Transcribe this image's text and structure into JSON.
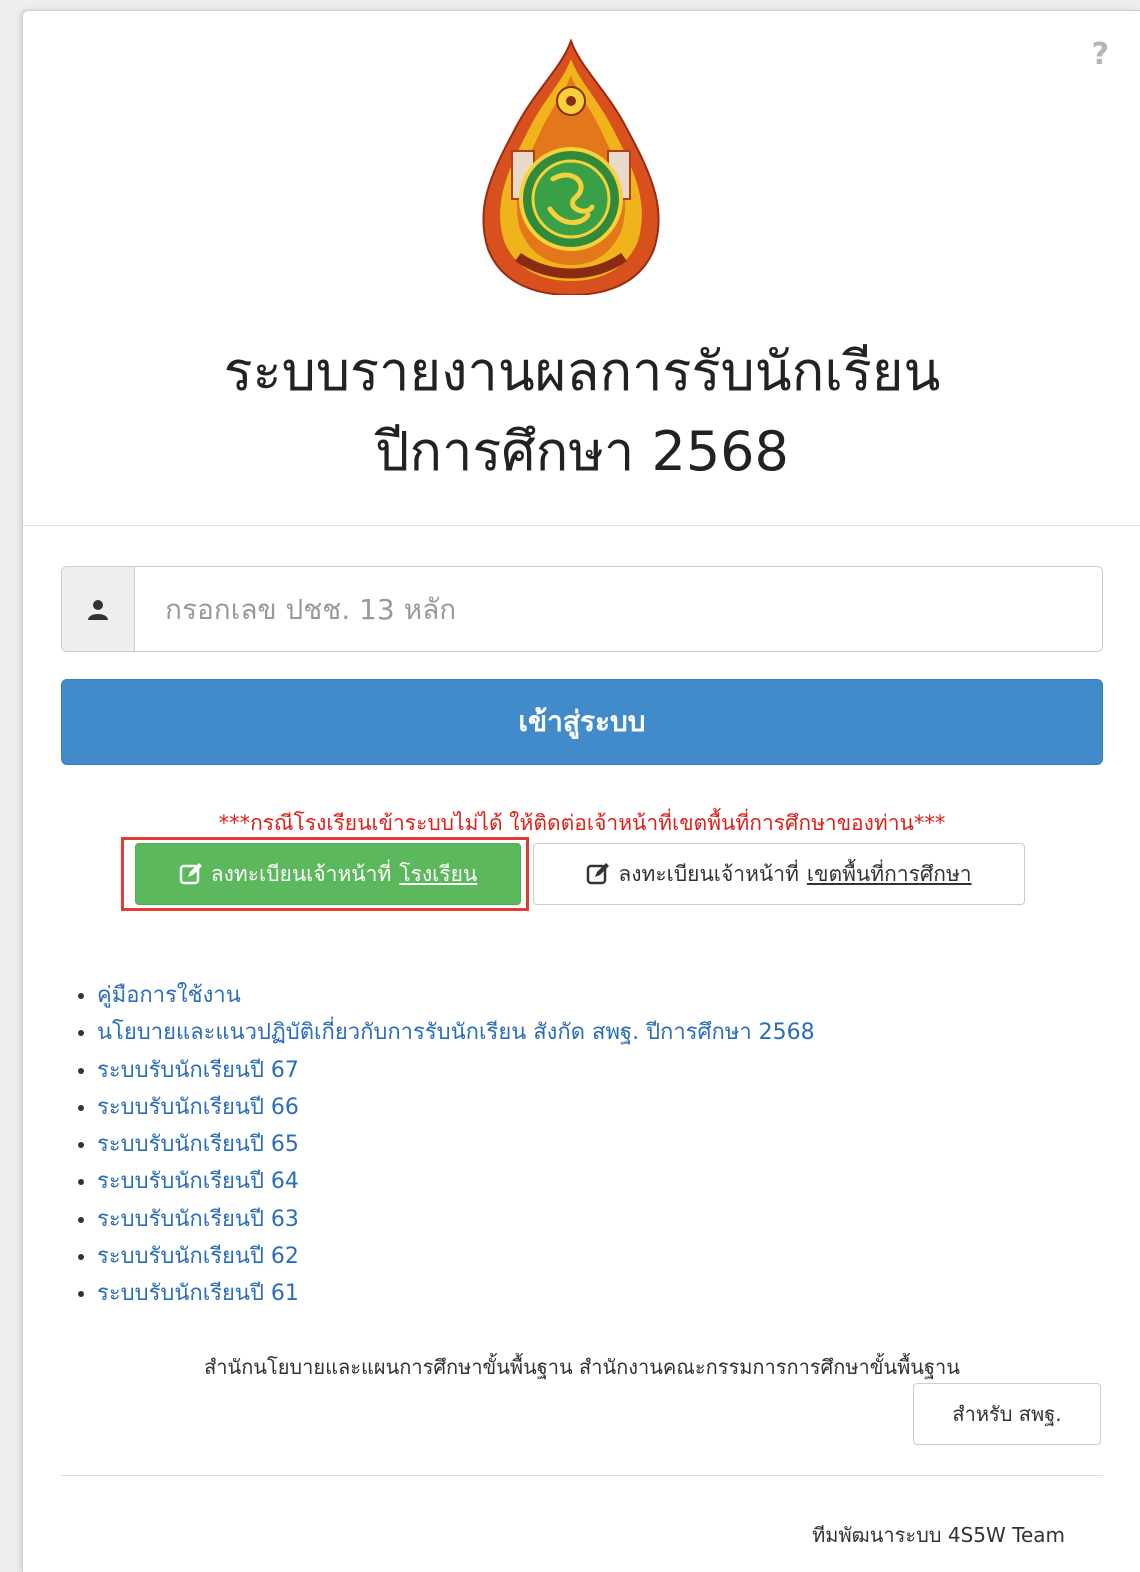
{
  "help": {
    "label": "?"
  },
  "title": {
    "line1": "ระบบรายงานผลการรับนักเรียน",
    "line2": "ปีการศึกษา 2568"
  },
  "login": {
    "id_placeholder": "กรอกเลข ปชช. 13 หลัก",
    "id_value": "",
    "submit_label": "เข้าสู่ระบบ"
  },
  "warning": "***กรณีโรงเรียนเข้าระบบไม่ได้ ให้ติดต่อเจ้าหน้าที่เขตพื้นที่การศึกษาของท่าน***",
  "register": {
    "school": {
      "prefix": "ลงทะเบียนเจ้าหน้าที่",
      "target": "โรงเรียน"
    },
    "area": {
      "prefix": "ลงทะเบียนเจ้าหน้าที่",
      "target": "เขตพื้นที่การศึกษา"
    }
  },
  "links": [
    "คู่มือการใช้งาน",
    "นโยบายและแนวปฏิบัติเกี่ยวกับการรับนักเรียน สังกัด สพฐ. ปีการศึกษา 2568",
    "ระบบรับนักเรียนปี 67",
    "ระบบรับนักเรียนปี 66",
    "ระบบรับนักเรียนปี 65",
    "ระบบรับนักเรียนปี 64",
    "ระบบรับนักเรียนปี 63",
    "ระบบรับนักเรียนปี 62",
    "ระบบรับนักเรียนปี 61"
  ],
  "footer": {
    "office": "สำนักนโยบายและแผนการศึกษาขั้นพื้นฐาน สำนักงานคณะกรรมการการศึกษาขั้นพื้นฐาน",
    "spp_button": "สำหรับ สพฐ.",
    "team": "ทีมพัฒนาระบบ 4S5W Team"
  },
  "colors": {
    "primary": "#428bca",
    "success": "#5cb85c",
    "warning_text": "#e0201a",
    "link": "#2a6ebb",
    "highlight": "#e53935"
  },
  "icons": [
    "help-icon",
    "user-icon",
    "edit-icon"
  ]
}
